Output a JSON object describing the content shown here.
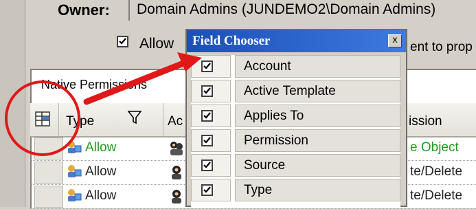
{
  "owner": {
    "label": "Owner:",
    "value": "Domain Admins (JUNDEMO2\\Domain Admins)"
  },
  "allow_option": {
    "label": "Allow",
    "tail_text": "ent to prop"
  },
  "section": {
    "title": "Native Permissions"
  },
  "columns": {
    "type": "Type",
    "account_partial": "Ac",
    "permission_partial": "ission"
  },
  "rows": [
    {
      "type": "Allow",
      "permission": "e Object",
      "color": "#1f9c1f"
    },
    {
      "type": "Allow",
      "permission": "te/Delete",
      "color": "#222222"
    },
    {
      "type": "Allow",
      "permission": "te/Delete",
      "color": "#222222"
    }
  ],
  "field_chooser": {
    "title": "Field Chooser",
    "close_glyph": "x",
    "items": [
      {
        "label": "Account",
        "checked": true
      },
      {
        "label": "Active Template",
        "checked": true
      },
      {
        "label": "Applies To",
        "checked": true
      },
      {
        "label": "Permission",
        "checked": true
      },
      {
        "label": "Source",
        "checked": true
      },
      {
        "label": "Type",
        "checked": true
      }
    ]
  },
  "annotation": {
    "circle_color": "#e01818",
    "arrow_color": "#e01818"
  }
}
